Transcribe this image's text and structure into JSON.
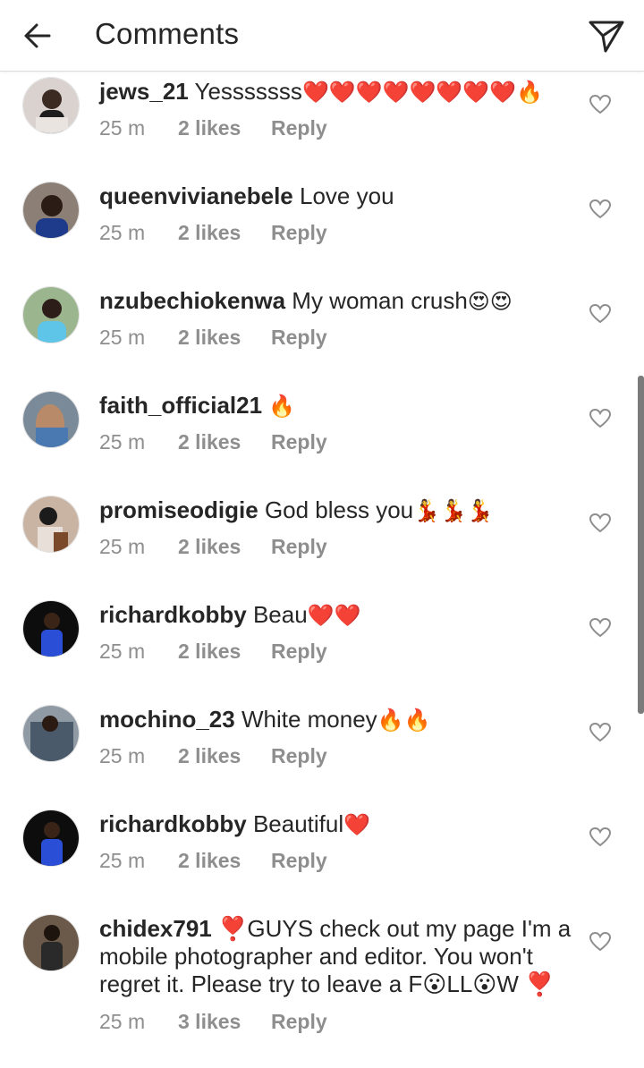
{
  "header": {
    "title": "Comments",
    "back_icon": "arrow-left-icon",
    "send_icon": "paper-plane-icon"
  },
  "colors": {
    "text": "#262626",
    "muted": "#8e8e8e",
    "divider": "#dbdbdb"
  },
  "comments": [
    {
      "username": "jews_21",
      "text": "Yesssssss",
      "emoji": "❤️❤️❤️❤️❤️❤️❤️❤️🔥",
      "time": "25 m",
      "likes": "2 likes",
      "reply": "Reply"
    },
    {
      "username": "queenvivianebele",
      "text": "Love you",
      "emoji": "",
      "time": "25 m",
      "likes": "2 likes",
      "reply": "Reply"
    },
    {
      "username": "nzubechiokenwa",
      "text": "My woman crush",
      "emoji": "😍😍",
      "time": "25 m",
      "likes": "2 likes",
      "reply": "Reply"
    },
    {
      "username": "faith_official21",
      "text": "",
      "emoji": "🔥",
      "time": "25 m",
      "likes": "2 likes",
      "reply": "Reply"
    },
    {
      "username": "promiseodigie",
      "text": "God bless you",
      "emoji": "💃💃💃",
      "time": "25 m",
      "likes": "2 likes",
      "reply": "Reply"
    },
    {
      "username": "richardkobby",
      "text": "Beau",
      "emoji": "❤️❤️",
      "time": "25 m",
      "likes": "2 likes",
      "reply": "Reply"
    },
    {
      "username": "mochino_23",
      "text": "White money",
      "emoji": "🔥🔥",
      "time": "25 m",
      "likes": "2 likes",
      "reply": "Reply"
    },
    {
      "username": "richardkobby",
      "text": "Beautiful",
      "emoji": "❤️",
      "time": "25 m",
      "likes": "2 likes",
      "reply": "Reply"
    },
    {
      "username": "chidex791",
      "text": "❣️GUYS check out my page I'm a mobile photographer and editor. You won't regret it. Please try to leave a F😮LL😮W ❣️",
      "emoji": "",
      "time": "25 m",
      "likes": "3 likes",
      "reply": "Reply"
    }
  ]
}
